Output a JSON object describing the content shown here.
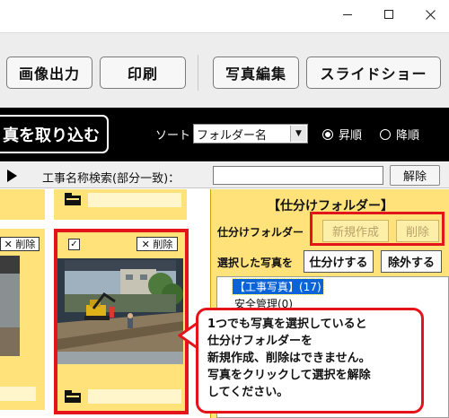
{
  "window_controls": {
    "minimize_icon": "minimize-icon",
    "maximize_icon": "maximize-icon",
    "close_icon": "close-icon"
  },
  "toolbar": {
    "buttons": [
      "画像出力",
      "印刷",
      "写真編集",
      "スライドショー"
    ]
  },
  "importbar": {
    "import_label": "真を取り込む",
    "sort_label": "ソート",
    "sort_value": "フォルダー名",
    "order_options": [
      "昇順",
      "降順"
    ],
    "order_selected": "昇順"
  },
  "searchbar": {
    "label": "工事名称検索(部分一致)：",
    "value": "",
    "clear_label": "解除"
  },
  "grid": {
    "delete_label": "✕ 削除",
    "checked_mark": "✓"
  },
  "folder_panel": {
    "title": "【仕分けフォルダー】",
    "folder_label": "仕分けフォルダー",
    "new_label": "新規作成",
    "delete_label": "削除",
    "selected_label": "選択した写真を",
    "sort_button": "仕分けする",
    "exclude_button": "除外する",
    "tree": [
      "【工事写真】(17)",
      "安全管理(0)"
    ]
  },
  "callout": {
    "lines": [
      "1つでも写真を選択していると",
      "仕分けフォルダーを",
      "新規作成、削除はできません。",
      "写真をクリックして選択を解除",
      "してください。"
    ]
  },
  "colors": {
    "card": "#ffe27a",
    "highlight": "#e5141a",
    "selection": "#0a64d8"
  }
}
